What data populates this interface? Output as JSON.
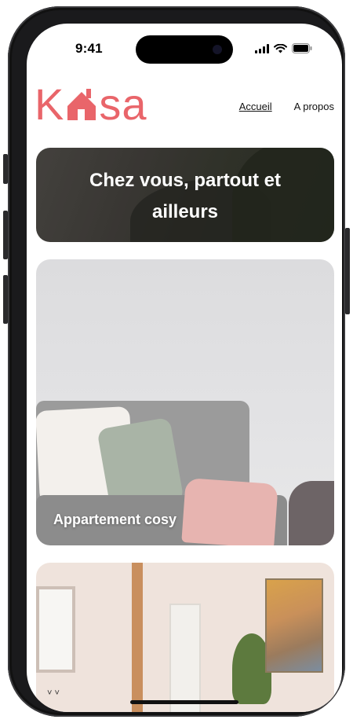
{
  "status_bar": {
    "time": "9:41"
  },
  "header": {
    "logo_before": "K",
    "logo_after": "sa",
    "nav": [
      {
        "label": "Accueil",
        "active": true
      },
      {
        "label": "A propos",
        "active": false
      }
    ]
  },
  "banner": {
    "title": "Chez vous, partout et ailleurs"
  },
  "cards": [
    {
      "title": "Appartement cosy"
    },
    {
      "title": ""
    }
  ],
  "footer": {
    "scroll_hint": "˅ ˅"
  },
  "colors": {
    "brand": "#e9656a",
    "frame": "#1a1a1c"
  }
}
